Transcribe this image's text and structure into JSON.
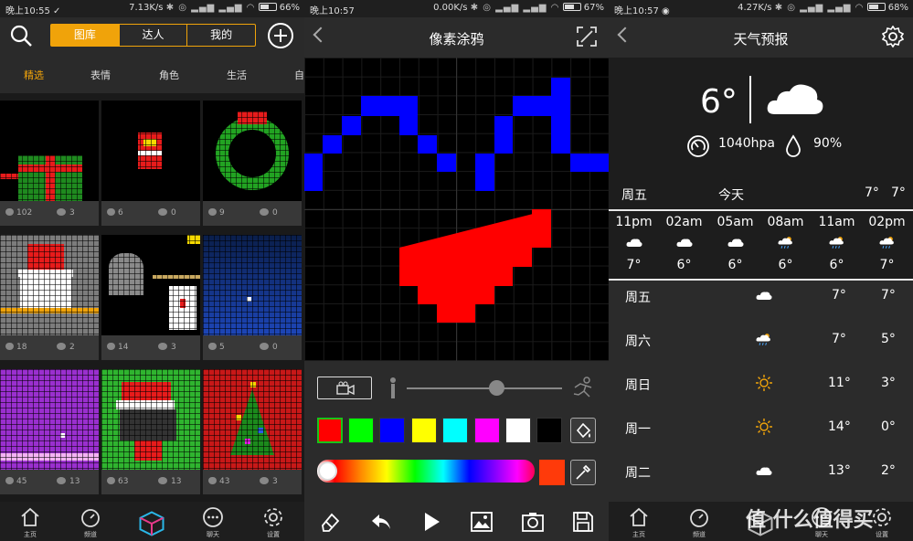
{
  "screens": [
    {
      "status": {
        "time": "晚上10:55",
        "speed": "7.13K/s",
        "battery": "66%",
        "battery_level": 0.66
      },
      "tabs": [
        "图库",
        "达人",
        "我的"
      ],
      "categories": [
        "精选",
        "表情",
        "角色",
        "生活",
        "自"
      ],
      "cards": [
        {
          "likes": "102",
          "comments": "3"
        },
        {
          "likes": "6",
          "comments": "0"
        },
        {
          "likes": "9",
          "comments": "0"
        },
        {
          "likes": "18",
          "comments": "2"
        },
        {
          "likes": "14",
          "comments": "3"
        },
        {
          "likes": "5",
          "comments": "0"
        },
        {
          "likes": "45",
          "comments": "13"
        },
        {
          "likes": "63",
          "comments": "13"
        },
        {
          "likes": "43",
          "comments": "3"
        }
      ],
      "nav": [
        "主页",
        "频道",
        "",
        "聊天",
        "设置"
      ]
    },
    {
      "status": {
        "time": "晚上10:57",
        "speed": "0.00K/s",
        "battery": "67%",
        "battery_level": 0.67
      },
      "title": "像素涂鸦",
      "swatches": [
        "#ff0000",
        "#00ff00",
        "#0000ff",
        "#ffff00",
        "#00ffff",
        "#ff00ff",
        "#ffffff",
        "#000000"
      ],
      "current_color": "#ff3a0a"
    },
    {
      "status": {
        "time": "晚上10:57",
        "speed": "4.27K/s",
        "battery": "68%",
        "battery_level": 0.68
      },
      "title": "天气预报",
      "current_temp": "6°",
      "pressure": "1040hpa",
      "humidity": "90%",
      "today": {
        "day": "周五",
        "label": "今天",
        "high": "7°",
        "low": "7°"
      },
      "hourly": [
        {
          "time": "11pm",
          "temp": "7°",
          "icon": "cloud-icon"
        },
        {
          "time": "02am",
          "temp": "6°",
          "icon": "cloud-icon"
        },
        {
          "time": "05am",
          "temp": "6°",
          "icon": "cloud-icon"
        },
        {
          "time": "08am",
          "temp": "6°",
          "icon": "rain-cloud-icon"
        },
        {
          "time": "11am",
          "temp": "6°",
          "icon": "rain-cloud-icon"
        },
        {
          "time": "02pm",
          "temp": "7°",
          "icon": "rain-cloud-icon"
        }
      ],
      "daily": [
        {
          "day": "周五",
          "high": "7°",
          "low": "7°",
          "icon": "cloud-icon"
        },
        {
          "day": "周六",
          "high": "7°",
          "low": "5°",
          "icon": "rain-cloud-icon"
        },
        {
          "day": "周日",
          "high": "11°",
          "low": "3°",
          "icon": "sun-icon"
        },
        {
          "day": "周一",
          "high": "14°",
          "low": "0°",
          "icon": "sun-icon"
        },
        {
          "day": "周二",
          "high": "13°",
          "low": "2°",
          "icon": "cloud-icon"
        }
      ],
      "nav": [
        "主页",
        "频道",
        "",
        "聊天",
        "设置"
      ]
    }
  ],
  "watermark": "值 什么值得买"
}
